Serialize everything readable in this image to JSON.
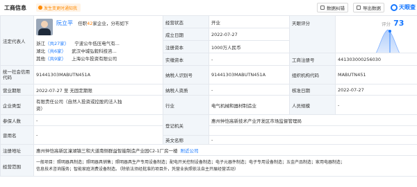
{
  "header": {
    "title": "工商信息",
    "badge": "发生变更时通知我",
    "btn_report": "数据纠错",
    "btn_export": "导出数据",
    "logo": "天眼查"
  },
  "rep": {
    "label": "法定代表人",
    "name": "阮立平",
    "role_pre": "任职",
    "role_count": "42",
    "role_post": "家企业，分布如下",
    "dist": [
      {
        "region": "浙江",
        "count": "（共27家）",
        "company": "宁波公牛低压电气有..."
      },
      {
        "region": "湖北",
        "count": "（共6家）",
        "company": "武汉中城弘毅科技咨..."
      },
      {
        "region": "其他",
        "count": "（共9家）",
        "company": "上海公牛投资有限公司"
      }
    ]
  },
  "status": {
    "label": "经营状态",
    "value": "开业"
  },
  "established": {
    "label": "成立日期",
    "value": "2022-07-27"
  },
  "capital": {
    "label": "注册资本",
    "value": "1000万人民币"
  },
  "paid": {
    "label": "实缴资本",
    "value": "-"
  },
  "score": {
    "label": "天眼评分",
    "text": "评分",
    "value": "73"
  },
  "regno": {
    "label": "工商注册号",
    "value": "441303000256030"
  },
  "credit": {
    "label": "统一社会信用代码",
    "value": "91441303MABUTN451A"
  },
  "taxid": {
    "label": "纳税人识别号",
    "value": "91441303MABUTN451A"
  },
  "orgcode": {
    "label": "组织机构代码",
    "value": "MABUTN451"
  },
  "term": {
    "label": "营业期限",
    "value": "2022-07-27 至 无固定期限"
  },
  "taxqual": {
    "label": "纳税人资质",
    "value": "-"
  },
  "approve": {
    "label": "核准日期",
    "value": "2022-07-27"
  },
  "type": {
    "label": "企业类型",
    "value1": "有限责任公司（自然人投资或控股的法人独",
    "value2": "资）"
  },
  "industry": {
    "label": "行业",
    "value": "电气机械和器材制造业"
  },
  "staff": {
    "label": "人员规模",
    "value": "-"
  },
  "insured": {
    "label": "参保人数",
    "value": "-"
  },
  "authority": {
    "label": "登记机关",
    "value": "惠州仲恺高新技术产业开发区市场监督管理局"
  },
  "formername": {
    "label": "曾用名",
    "value": "-"
  },
  "engname": {
    "label": "英文名称",
    "value": "-"
  },
  "address": {
    "label": "注册地址",
    "value": "惠州仲恺高新区潼湖镇三和大道南侧群益智能制造产业园C2-1厂房一楼",
    "link": "附近公司"
  },
  "scope": {
    "label": "经营范围",
    "line1": "一般项目：照明器具制造；照明器具销售；照明器具生产专用设备制造；配电开关控制设备制造；电子元器件制造；电子专用设备制造；五金产品制造；家用电器制造；",
    "line2": "信息技术咨询服务；智能家庭消费设备制造。（除依法须经批准的项目外，凭营业执照依法自主开展经营活动）"
  }
}
